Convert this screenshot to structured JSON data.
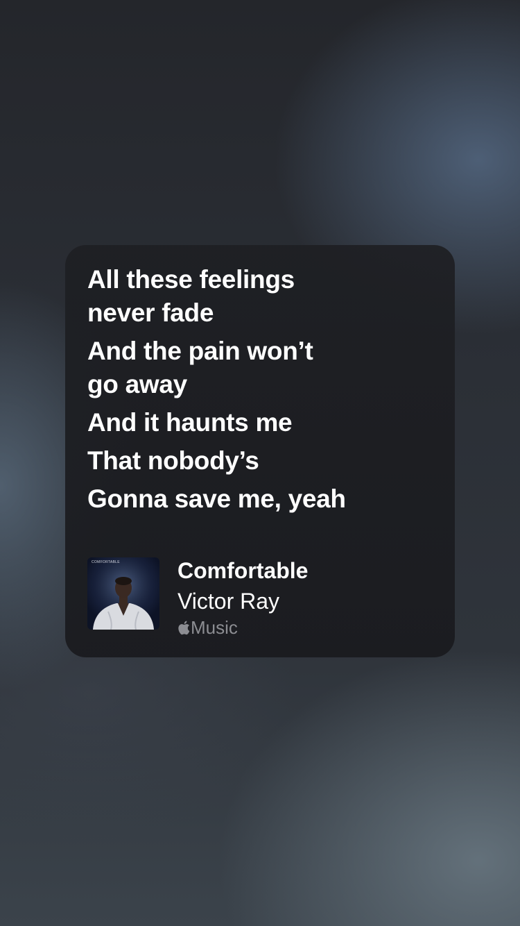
{
  "lyrics": {
    "lines": [
      "All these feelings",
      "never fade",
      "And the pain won’t",
      "go away",
      "And it haunts me",
      "That nobody’s",
      "Gonna save me, yeah"
    ]
  },
  "track": {
    "title": "Comfortable",
    "artist": "Victor Ray",
    "service_label": "Music",
    "service_icon": "apple-logo-icon",
    "artwork_text": "COMFORTABLE"
  },
  "colors": {
    "card_background": "#1e1f23",
    "lyric_text": "#ffffff",
    "service_text": "#8c8d92"
  }
}
